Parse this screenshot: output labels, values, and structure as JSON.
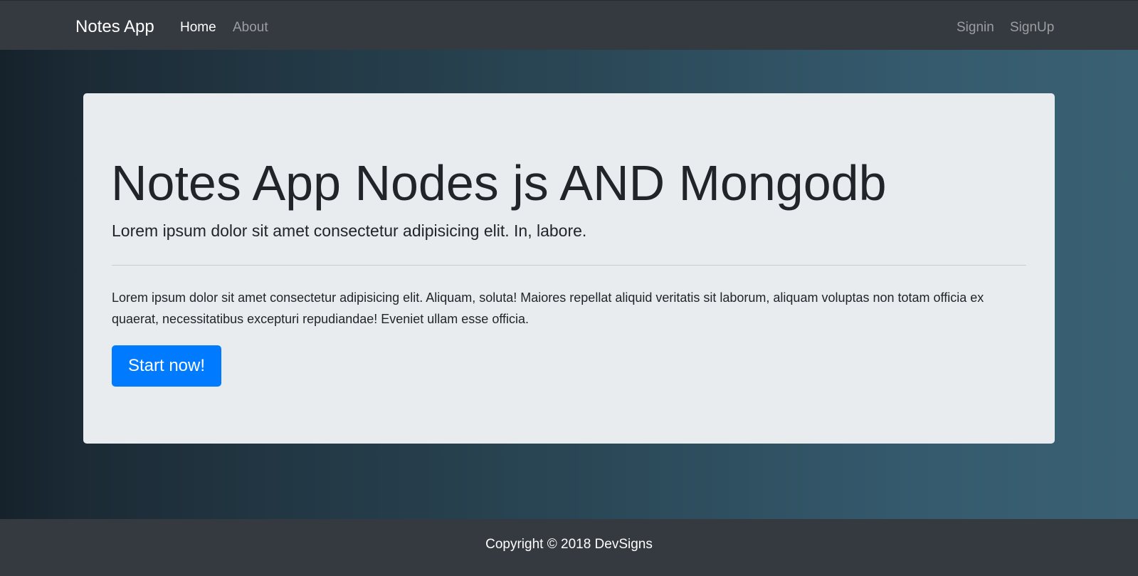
{
  "navbar": {
    "brand": "Notes App",
    "links": [
      {
        "label": "Home",
        "active": true
      },
      {
        "label": "About",
        "active": false
      }
    ],
    "auth_links": [
      {
        "label": "Signin"
      },
      {
        "label": "SignUp"
      }
    ]
  },
  "jumbotron": {
    "title": "Notes App Nodes js AND Mongodb",
    "lead": "Lorem ipsum dolor sit amet consectetur adipisicing elit. In, labore.",
    "body": "Lorem ipsum dolor sit amet consectetur adipisicing elit. Aliquam, soluta! Maiores repellat aliquid veritatis sit laborum, aliquam voluptas non totam officia ex quaerat, necessitatibus excepturi repudiandae! Eveniet ullam esse officia.",
    "button_label": "Start now!"
  },
  "footer": {
    "copyright": "Copyright © 2018 DevSigns"
  },
  "colors": {
    "navbar_bg": "#343a40",
    "jumbotron_bg": "#e9ecef",
    "primary": "#007bff",
    "background_gradient_start": "#15222c",
    "background_gradient_end": "#3a6073"
  }
}
